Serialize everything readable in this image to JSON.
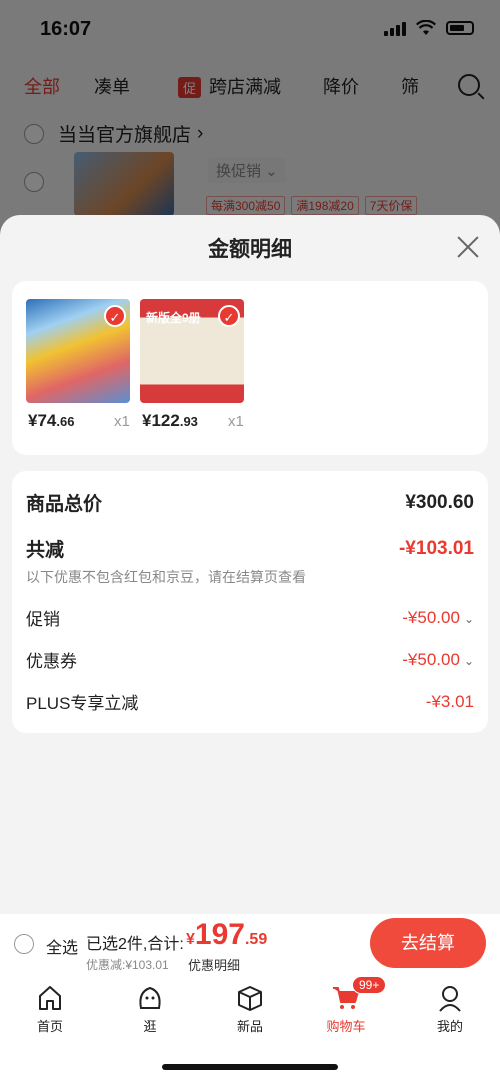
{
  "status_bar": {
    "time": "16:07"
  },
  "background": {
    "tabs": [
      "全部",
      "凑单",
      "跨店满减",
      "降价",
      "筛"
    ],
    "promo_tag": "促",
    "store_name": "当当官方旗舰店",
    "store_chevron": "›",
    "change_promo": "换促销 ⌄",
    "item_tags": [
      "每满300减50",
      "满198减20",
      "7天价保"
    ]
  },
  "sheet": {
    "title": "金额明细",
    "products": [
      {
        "price_int": "¥74",
        "price_dec": ".66",
        "qty": "x1",
        "check": "✓"
      },
      {
        "price_int": "¥122",
        "price_dec": ".93",
        "qty": "x1",
        "ribbon": "新版全9册",
        "check": "✓"
      }
    ],
    "summary": {
      "total_label": "商品总价",
      "total_value": "¥300.60",
      "reduce_label": "共减",
      "reduce_value": "-¥103.01",
      "note": "以下优惠不包含红包和京豆，请在结算页查看",
      "promo_label": "促销",
      "promo_value": "-¥50.00",
      "coupon_label": "优惠券",
      "coupon_value": "-¥50.00",
      "plus_label": "PLUS专享立减",
      "plus_value": "-¥3.01",
      "chevron": "⌄"
    }
  },
  "checkout": {
    "select_all": "全选",
    "selected_info": "已选2件,合计:",
    "price_cur": "¥",
    "price_int": "197",
    "price_dec": ".59",
    "discount_line": "优惠减:¥103.01",
    "discount_detail": "优惠明细",
    "button": "去结算"
  },
  "tab_bar": {
    "items": [
      "首页",
      "逛",
      "新品",
      "购物车",
      "我的"
    ],
    "cart_badge": "99+"
  },
  "colors": {
    "accent": "#e83a30",
    "button": "#f04a3c"
  }
}
